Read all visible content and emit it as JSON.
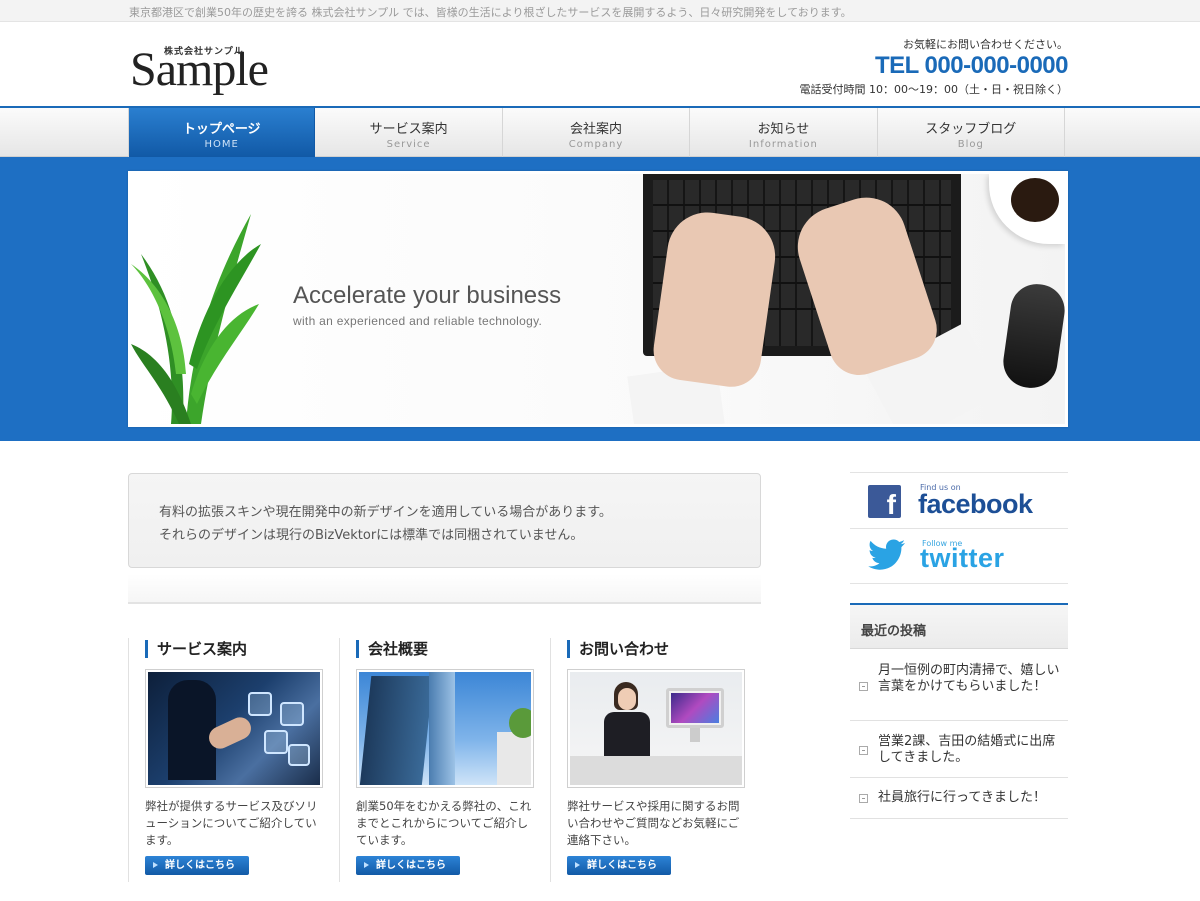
{
  "topbar": {
    "text": "東京都港区で創業50年の歴史を誇る 株式会社サンプル では、皆様の生活により根ざしたサービスを展開するよう、日々研究開発をしております。"
  },
  "header": {
    "logo_small": "株式会社サンプル",
    "logo_main": "Sample",
    "contact_line1": "お気軽にお問い合わせください。",
    "tel": "TEL 000-000-0000",
    "hours": "電話受付時間 10：00〜19：00（土・日・祝日除く）"
  },
  "nav": [
    {
      "jp": "トップページ",
      "en": "HOME",
      "active": true
    },
    {
      "jp": "サービス案内",
      "en": "Service",
      "active": false
    },
    {
      "jp": "会社案内",
      "en": "Company",
      "active": false
    },
    {
      "jp": "お知らせ",
      "en": "Information",
      "active": false
    },
    {
      "jp": "スタッフブログ",
      "en": "Blog",
      "active": false
    }
  ],
  "hero": {
    "title": "Accelerate your business",
    "subtitle": "with an experienced and reliable technology."
  },
  "notice": {
    "line1": "有料の拡張スキンや現在開発中の新デザインを適用している場合があります。",
    "line2": "それらのデザインは現行のBizVektorには標準では同梱されていません。"
  },
  "columns": [
    {
      "title": "サービス案内",
      "desc": "弊社が提供するサービス及びソリューションについてご紹介しています。",
      "button": "詳しくはこちら"
    },
    {
      "title": "会社概要",
      "desc": "創業50年をむかえる弊社の、これまでとこれからについてご紹介しています。",
      "button": "詳しくはこちら"
    },
    {
      "title": "お問い合わせ",
      "desc": "弊社サービスや採用に関するお問い合わせやご質問などお気軽にご連絡下さい。",
      "button": "詳しくはこちら"
    }
  ],
  "sidebar": {
    "facebook_small": "Find us on",
    "facebook_big": "facebook",
    "twitter_small": "Follow me",
    "twitter_big": "twitter",
    "recent_heading": "最近の投稿",
    "posts": [
      "月一恒例の町内清掃で、嬉しい言葉をかけてもらいました！",
      "営業2課、吉田の結婚式に出席してきました。",
      "社員旅行に行ってきました！"
    ]
  },
  "colors": {
    "accent": "#1a6ab8",
    "hero_bg": "#1e6fc3"
  }
}
